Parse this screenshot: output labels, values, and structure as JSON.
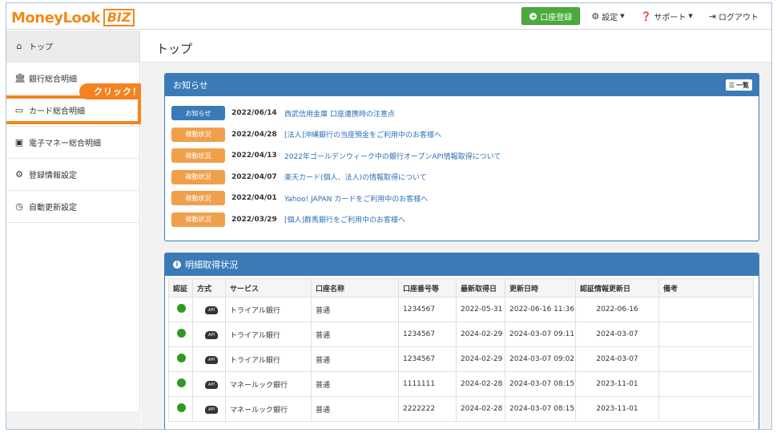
{
  "header": {
    "logo_text": "MoneyLook",
    "logo_biz": "BIZ",
    "register_button": "口座登録",
    "settings": "設定",
    "support": "サポート",
    "logout": "ログアウト"
  },
  "sidebar": {
    "items": [
      {
        "label": "トップ",
        "icon": "home-icon"
      },
      {
        "label": "銀行総合明細",
        "icon": "bank-icon"
      },
      {
        "label": "カード総合明細",
        "icon": "card-icon"
      },
      {
        "label": "電子マネー総合明細",
        "icon": "money-icon"
      },
      {
        "label": "登録情報設定",
        "icon": "gear-icon"
      },
      {
        "label": "自動更新設定",
        "icon": "clock-icon"
      }
    ],
    "click_badge": "クリック！",
    "highlight_color": "#f58220"
  },
  "main": {
    "page_title": "トップ",
    "notice": {
      "title": "お知らせ",
      "list_button": "一覧",
      "items": [
        {
          "tag": "お知らせ",
          "tag_color": "blue",
          "date": "2022/06/14",
          "title": "西武信用金庫 口座連携時の注意点"
        },
        {
          "tag": "稼動状況",
          "tag_color": "orange",
          "date": "2022/04/28",
          "title": "[法人]沖縄銀行の当座預金をご利用中のお客様へ"
        },
        {
          "tag": "稼動状況",
          "tag_color": "orange",
          "date": "2022/04/13",
          "title": "2022年ゴールデンウィーク中の銀行オープンAPI情報取得について"
        },
        {
          "tag": "稼動状況",
          "tag_color": "orange",
          "date": "2022/04/07",
          "title": "楽天カード(個人、法人)の情報取得について"
        },
        {
          "tag": "稼動状況",
          "tag_color": "orange",
          "date": "2022/04/01",
          "title": "Yahoo! JAPAN カードをご利用中のお客様へ"
        },
        {
          "tag": "稼動状況",
          "tag_color": "orange",
          "date": "2022/03/29",
          "title": "[個人]群馬銀行をご利用中のお客様へ"
        }
      ]
    },
    "status": {
      "title": "明細取得状況",
      "columns": [
        "認証",
        "方式",
        "サービス",
        "口座名称",
        "口座番号等",
        "最新取得日",
        "更新日時",
        "認証情報更新日",
        "備考"
      ],
      "rows": [
        {
          "method": "API",
          "service": "トライアル銀行",
          "account_name": "普通",
          "account_no": "1234567",
          "latest": "2022-05-31",
          "updated": "2022-06-16 11:36",
          "auth_updated": "2022-06-16",
          "note": ""
        },
        {
          "method": "API",
          "service": "トライアル銀行",
          "account_name": "普通",
          "account_no": "1234567",
          "latest": "2024-02-29",
          "updated": "2024-03-07 09:11",
          "auth_updated": "2024-03-07",
          "note": ""
        },
        {
          "method": "API",
          "service": "トライアル銀行",
          "account_name": "普通",
          "account_no": "1234567",
          "latest": "2024-02-29",
          "updated": "2024-03-07 09:02",
          "auth_updated": "2024-03-07",
          "note": ""
        },
        {
          "method": "API",
          "service": "マネールック銀行",
          "account_name": "普通",
          "account_no": "1111111",
          "latest": "2024-02-28",
          "updated": "2024-03-07 08:15",
          "auth_updated": "2023-11-01",
          "note": ""
        },
        {
          "method": "API",
          "service": "マネールック銀行",
          "account_name": "普通",
          "account_no": "2222222",
          "latest": "2024-02-28",
          "updated": "2024-03-07 08:15",
          "auth_updated": "2023-11-01",
          "note": ""
        }
      ]
    }
  },
  "colors": {
    "accent_blue": "#3a7bb7",
    "brand_orange": "#f08a1c",
    "ok_green": "#2e9a23",
    "register_green": "#4aab3c"
  }
}
